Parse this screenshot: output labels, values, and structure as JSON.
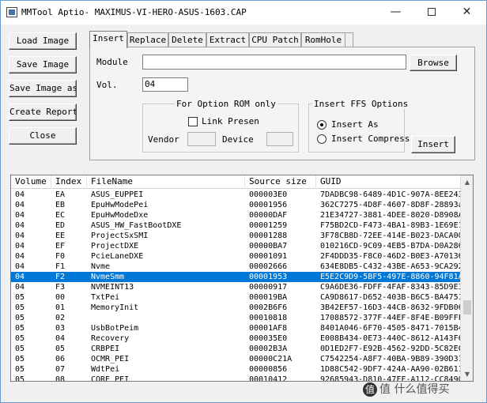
{
  "window": {
    "title": "MMTool Aptio- MAXIMUS-VI-HERO-ASUS-1603.CAP",
    "icons": {
      "minimize": "minimize-icon",
      "maximize": "maximize-icon",
      "close": "close-icon"
    }
  },
  "sidebar": {
    "load_image": "Load Image",
    "save_image": "Save Image",
    "save_image_as": "Save Image as..",
    "create_report": "Create Report",
    "close": "Close"
  },
  "tabs": [
    "Insert",
    "Replace",
    "Delete",
    "Extract",
    "CPU Patch",
    "RomHole"
  ],
  "insert_panel": {
    "module_label": "Module",
    "module_value": "",
    "browse_label": "Browse",
    "vol_label": "Vol.",
    "vol_value": "04",
    "option_rom_title": "For Option ROM only",
    "link_present_label": "Link Presen",
    "link_present_checked": false,
    "vendor_label": "Vendor",
    "vendor_value": "",
    "device_label": "Device",
    "device_value": "",
    "ffs_title": "Insert FFS Options",
    "insert_as_label": "Insert As",
    "insert_as_selected": true,
    "insert_compress_label": "Insert Compress",
    "insert_compress_selected": false,
    "insert_button": "Insert"
  },
  "table": {
    "columns": [
      "Volume",
      "Index",
      "FileName",
      "Source size",
      "GUID"
    ],
    "selected_index": 8,
    "rows": [
      [
        "04",
        "EA",
        "ASUS_EUPPEI",
        "000003E0",
        "7DADBC98-6489-4D1C-907A-8EE243"
      ],
      [
        "04",
        "EB",
        "EpuHwModePei",
        "00001956",
        "362C7275-4D8F-4607-8D8F-28893a"
      ],
      [
        "04",
        "EC",
        "EpuHwModeDxe",
        "00000DAF",
        "21E34727-3881-4DEE-8020-D8908A"
      ],
      [
        "04",
        "ED",
        "ASUS_HW_FastBootDXE",
        "00001259",
        "F75BD2CD-F473-4BA1-89B3-1E69E1"
      ],
      [
        "04",
        "EE",
        "ProjectSxSMI",
        "00001288",
        "3F78CB8D-72EE-414E-B023-DACA00"
      ],
      [
        "04",
        "EF",
        "ProjectDXE",
        "00000BA7",
        "010216CD-9C09-4EB5-B7DA-D0A286"
      ],
      [
        "04",
        "F0",
        "PcieLaneDXE",
        "00001091",
        "2F4DDD35-F8C0-46D2-B0E3-A70136"
      ],
      [
        "04",
        "F1",
        "Nvme",
        "00002666",
        "634E8DB5-C432-43BE-A653-9CA292"
      ],
      [
        "04",
        "F2",
        "NvmeSmm",
        "00001953",
        "E5E2C9D9-5BF5-497E-8860-94F81A"
      ],
      [
        "04",
        "F3",
        "NVMEINT13",
        "00000917",
        "C9A6DE36-FDFF-4FAF-8343-85D9E3"
      ],
      [
        "05",
        "00",
        "TxtPei",
        "000019BA",
        "CA9D8617-D652-403B-B6C5-BA4751"
      ],
      [
        "05",
        "01",
        "MemoryInit",
        "0002B6F6",
        "3B42EF57-16D3-44CB-8632-9FDB06"
      ],
      [
        "05",
        "02",
        "",
        "00010818",
        "17088572-377F-44EF-8F4E-B09FFF"
      ],
      [
        "05",
        "03",
        "UsbBotPeim",
        "00001AF8",
        "8401A046-6F70-4505-8471-7015B4"
      ],
      [
        "05",
        "04",
        "Recovery",
        "000035E0",
        "E008B434-0E73-440C-8612-A143F6"
      ],
      [
        "05",
        "05",
        "CRBPEI",
        "00002B3A",
        "0D1ED2F7-E92B-4562-92DD-5C82EC"
      ],
      [
        "05",
        "06",
        "OCMR_PEI",
        "00000C21A",
        "C7542254-A8F7-40BA-9B89-390D31"
      ],
      [
        "05",
        "07",
        "WdtPei",
        "00000856",
        "1D88C542-9DF7-424A-AA90-02B611"
      ],
      [
        "05",
        "08",
        "CORE_PEI",
        "00010412",
        "92685943-D810-47FF-A112-CC8490"
      ]
    ]
  },
  "watermark": {
    "text": "值 什么值得买",
    "logo": "值"
  }
}
